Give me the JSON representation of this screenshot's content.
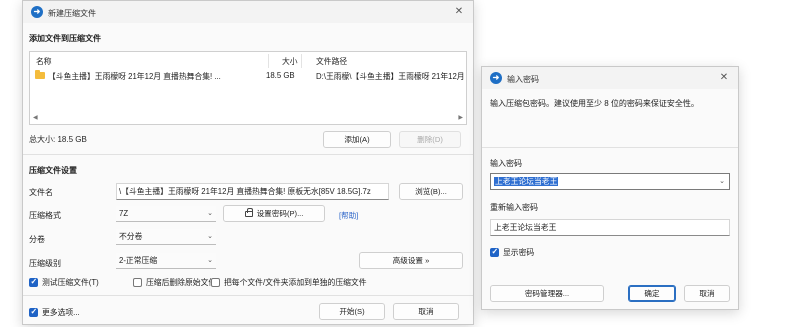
{
  "left_window": {
    "title": "新建压缩文件",
    "add_section": "添加文件到压缩文件",
    "columns": [
      "名称",
      "大小",
      "文件路径"
    ],
    "rows": [
      {
        "name": "【斗鱼主播】王雨檬呀 21年12月 直播热舞合集! ...",
        "size": "18.5 GB",
        "path": "D:\\王雨檬\\【斗鱼主播】王雨檬呀 21年12月 直"
      }
    ],
    "total_size": "总大小: 18.5 GB",
    "add_button": "添加(A)",
    "delete_button": "删除(D)",
    "settings_section": "压缩文件设置",
    "filename_label": "文件名",
    "filename_value": "\\【斗鱼主播】王雨檬呀 21年12月 直播热舞合集! 原板无水[85V 18.5G].7z",
    "browse_button": "浏览(B)...",
    "format_label": "压缩格式",
    "format_value": "7Z",
    "set_password_button": "设置密码(P)...",
    "help_link": "[帮助]",
    "split_label": "分卷",
    "split_value": "不分卷",
    "level_label": "压缩级别",
    "level_value": "2-正常压缩",
    "advanced_button": "高级设置 »",
    "test_checkbox": "测试压缩文件(T)",
    "delete_source_checkbox": "压缩后删除原始文件",
    "separate_checkbox": "把每个文件/文件夹添加到单独的压缩文件",
    "more_options": "更多选项...",
    "start_button": "开始(S)",
    "cancel_button": "取消"
  },
  "right_window": {
    "title": "输入密码",
    "hint": "输入压缩包密码。建议使用至少 8 位的密码来保证安全性。",
    "password_label": "输入密码",
    "password_value": "上老王论坛当老王",
    "reenter_label": "重新输入密码",
    "reenter_value": "上老王论坛当老王",
    "show_password": "显示密码",
    "manager_button": "密码管理器...",
    "ok_button": "确定",
    "cancel_button": "取消"
  },
  "colors": {
    "accent": "#1f63c6",
    "selection": "#2f6fd1"
  }
}
